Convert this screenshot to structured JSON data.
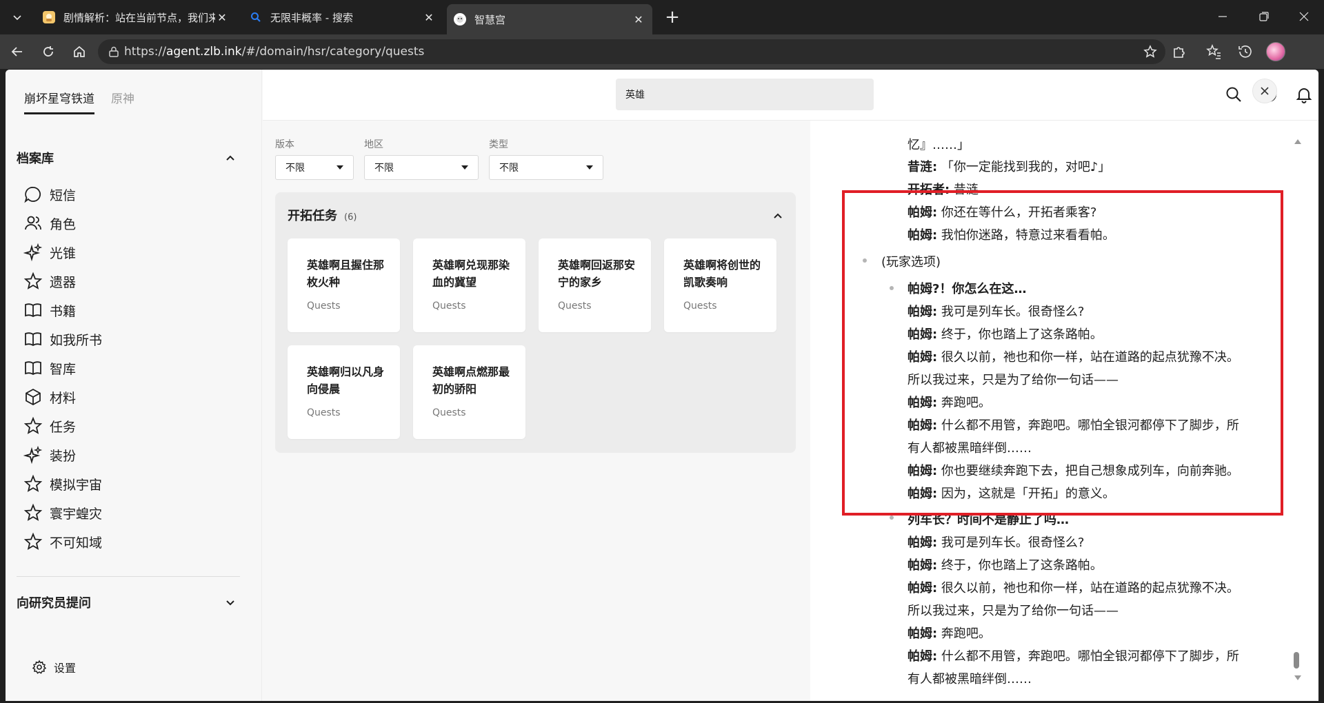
{
  "browser": {
    "tabs": [
      {
        "title": "剧情解析：站在当前节点，我们来",
        "close": "✕"
      },
      {
        "title": "无限非概率 - 搜索",
        "close": "✕"
      },
      {
        "title": "智慧宫",
        "close": "✕"
      }
    ],
    "new_tab": "+",
    "url_prefix": "https://",
    "url_host": "agent.zlb.ink",
    "url_path": "/#/domain/hsr/category/quests"
  },
  "sidebar": {
    "game_tabs": [
      "崩坏星穹铁道",
      "原神"
    ],
    "archive_title": "档案库",
    "items": [
      {
        "label": "短信",
        "icon": "message-icon"
      },
      {
        "label": "角色",
        "icon": "people-icon"
      },
      {
        "label": "光锥",
        "icon": "sparkle-icon"
      },
      {
        "label": "遗器",
        "icon": "star-icon"
      },
      {
        "label": "书籍",
        "icon": "book-icon"
      },
      {
        "label": "如我所书",
        "icon": "book-icon"
      },
      {
        "label": "智库",
        "icon": "book-icon"
      },
      {
        "label": "材料",
        "icon": "cube-icon"
      },
      {
        "label": "任务",
        "icon": "star-icon"
      },
      {
        "label": "装扮",
        "icon": "sparkle-icon"
      },
      {
        "label": "模拟宇宙",
        "icon": "star-icon"
      },
      {
        "label": "寰宇蝗灾",
        "icon": "star-icon"
      },
      {
        "label": "不可知域",
        "icon": "star-icon"
      }
    ],
    "ask_title": "向研究员提问",
    "settings_label": "设置"
  },
  "search": {
    "value": "英雄"
  },
  "filters": [
    {
      "label": "版本",
      "value": "不限"
    },
    {
      "label": "地区",
      "value": "不限"
    },
    {
      "label": "类型",
      "value": "不限"
    }
  ],
  "quest_panel": {
    "title": "开拓任务",
    "count": "(6)",
    "cards": [
      {
        "title": "英雄啊且握住那枚火种",
        "sub": "Quests"
      },
      {
        "title": "英雄啊兑现那染血的冀望",
        "sub": "Quests"
      },
      {
        "title": "英雄啊回返那安宁的家乡",
        "sub": "Quests"
      },
      {
        "title": "英雄啊将创世的凯歌奏响",
        "sub": "Quests"
      },
      {
        "title": "英雄啊归以凡身向侵晨",
        "sub": "Quests"
      },
      {
        "title": "英雄啊点燃那最初的骄阳",
        "sub": "Quests"
      }
    ]
  },
  "reader": {
    "lines": [
      {
        "speaker": "",
        "text": "忆』……」"
      },
      {
        "speaker": "昔涟:",
        "text": " 「你一定能找到我的，对吧♪」"
      },
      {
        "speaker": "开拓者:",
        "text": " 昔涟"
      },
      {
        "speaker": "帕姆:",
        "text": " 你还在等什么，开拓者乘客?"
      },
      {
        "speaker": "帕姆:",
        "text": " 我怕你迷路，特意过来看看帕。"
      },
      {
        "speaker": "",
        "text": "(玩家选项)"
      },
      {
        "speaker": "帕姆?！你怎么在这…",
        "text": ""
      },
      {
        "speaker": "帕姆:",
        "text": " 我可是列车长。很奇怪么?"
      },
      {
        "speaker": "帕姆:",
        "text": " 终于，你也踏上了这条路帕。"
      },
      {
        "speaker": "帕姆:",
        "text": " 很久以前，祂也和你一样，站在道路的起点犹豫不决。"
      },
      {
        "speaker": "",
        "text": "所以我过来，只是为了给你一句话——"
      },
      {
        "speaker": "帕姆:",
        "text": " 奔跑吧。"
      },
      {
        "speaker": "帕姆:",
        "text": " 什么都不用管，奔跑吧。哪怕全银河都停下了脚步，所"
      },
      {
        "speaker": "",
        "text": "有人都被黑暗绊倒……"
      },
      {
        "speaker": "帕姆:",
        "text": " 你也要继续奔跑下去，把自己想象成列车，向前奔驰。"
      },
      {
        "speaker": "帕姆:",
        "text": " 因为，这就是「开拓」的意义。"
      },
      {
        "speaker": "列车长？时间不是静止了吗…",
        "text": ""
      },
      {
        "speaker": "帕姆:",
        "text": " 我可是列车长。很奇怪么?"
      },
      {
        "speaker": "帕姆:",
        "text": " 终于，你也踏上了这条路帕。"
      },
      {
        "speaker": "帕姆:",
        "text": " 很久以前，祂也和你一样，站在道路的起点犹豫不决。"
      },
      {
        "speaker": "",
        "text": "所以我过来，只是为了给你一句话——"
      },
      {
        "speaker": "帕姆:",
        "text": " 奔跑吧。"
      },
      {
        "speaker": "帕姆:",
        "text": " 什么都不用管，奔跑吧。哪怕全银河都停下了脚步，所"
      },
      {
        "speaker": "",
        "text": "有人都被黑暗绊倒……"
      }
    ],
    "highlight_color": "#e01e26"
  }
}
